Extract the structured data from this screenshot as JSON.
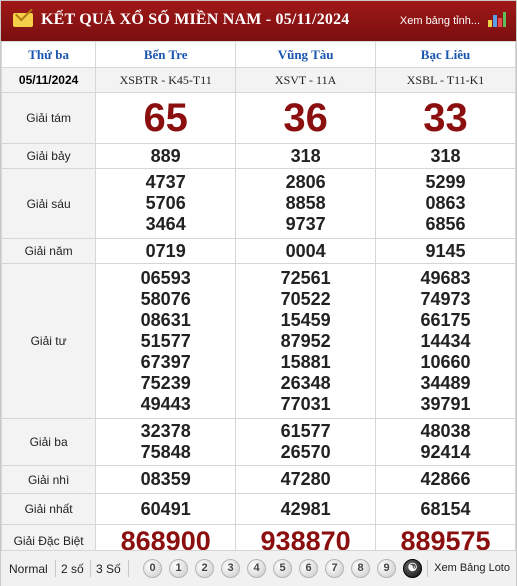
{
  "header": {
    "title": "KẾT QUẢ XỔ SỐ MIỀN NAM - 05/11/2024",
    "link": "Xem bảng tỉnh..."
  },
  "columns": {
    "day": "Thứ ba",
    "date": "05/11/2024",
    "provinces": [
      "Bến Tre",
      "Vũng Tàu",
      "Bạc Liêu"
    ],
    "codes": [
      "XSBTR - K45-T11",
      "XSVT - 11A",
      "XSBL - T11-K1"
    ]
  },
  "prizes": [
    {
      "label": "Giải tám",
      "values": [
        [
          "65"
        ],
        [
          "36"
        ],
        [
          "33"
        ]
      ]
    },
    {
      "label": "Giải bảy",
      "values": [
        [
          "889"
        ],
        [
          "318"
        ],
        [
          "318"
        ]
      ]
    },
    {
      "label": "Giải sáu",
      "values": [
        [
          "4737",
          "5706",
          "3464"
        ],
        [
          "2806",
          "8858",
          "9737"
        ],
        [
          "5299",
          "0863",
          "6856"
        ]
      ]
    },
    {
      "label": "Giải năm",
      "values": [
        [
          "0719"
        ],
        [
          "0004"
        ],
        [
          "9145"
        ]
      ]
    },
    {
      "label": "Giải tư",
      "values": [
        [
          "06593",
          "58076",
          "08631",
          "51577",
          "67397",
          "75239",
          "49443"
        ],
        [
          "72561",
          "70522",
          "15459",
          "87952",
          "15881",
          "26348",
          "77031"
        ],
        [
          "49683",
          "74973",
          "66175",
          "14434",
          "10660",
          "34489",
          "39791"
        ]
      ]
    },
    {
      "label": "Giải ba",
      "values": [
        [
          "32378",
          "75848"
        ],
        [
          "61577",
          "26570"
        ],
        [
          "48038",
          "92414"
        ]
      ]
    },
    {
      "label": "Giải nhì",
      "values": [
        [
          "08359"
        ],
        [
          "47280"
        ],
        [
          "42866"
        ]
      ]
    },
    {
      "label": "Giải nhất",
      "values": [
        [
          "60491"
        ],
        [
          "42981"
        ],
        [
          "68154"
        ]
      ]
    },
    {
      "label": "Giải Đặc Biệt",
      "values": [
        [
          "868900"
        ],
        [
          "938870"
        ],
        [
          "889575"
        ]
      ]
    }
  ],
  "footer": {
    "options": [
      "Normal",
      "2 số",
      "3 Số"
    ],
    "digits": [
      "0",
      "1",
      "2",
      "3",
      "4",
      "5",
      "6",
      "7",
      "8",
      "9"
    ],
    "loto_link": "Xem Bảng Loto"
  },
  "colors": {
    "header_bg": "#8b0f0f",
    "accent_red": "#8b0f0f",
    "province_blue": "#1a56b0"
  }
}
